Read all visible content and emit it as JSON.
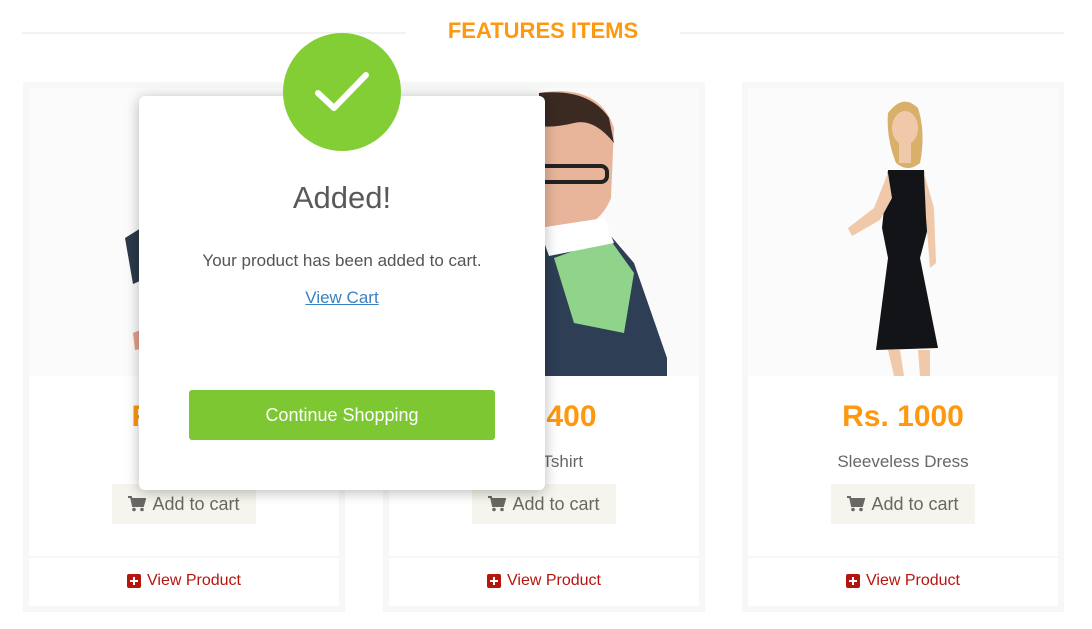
{
  "section": {
    "title": "FEATURES ITEMS"
  },
  "products": [
    {
      "price": "Rs. 500",
      "name": "",
      "add_label": "Add to cart",
      "view_label": "View Product"
    },
    {
      "price": "Rs. 400",
      "name": "Men Tshirt",
      "add_label": "Add to cart",
      "view_label": "View Product"
    },
    {
      "price": "Rs. 1000",
      "name": "Sleeveless Dress",
      "add_label": "Add to cart",
      "view_label": "View Product"
    }
  ],
  "modal": {
    "title": "Added!",
    "message": "Your product has been added to cart.",
    "link_label": "View Cart",
    "continue_label": "Continue Shopping",
    "icon": "check-icon",
    "accent": "#7cc732"
  },
  "colors": {
    "price": "#fe980f",
    "view_link": "#b6150e",
    "brand": "#fe980f"
  }
}
